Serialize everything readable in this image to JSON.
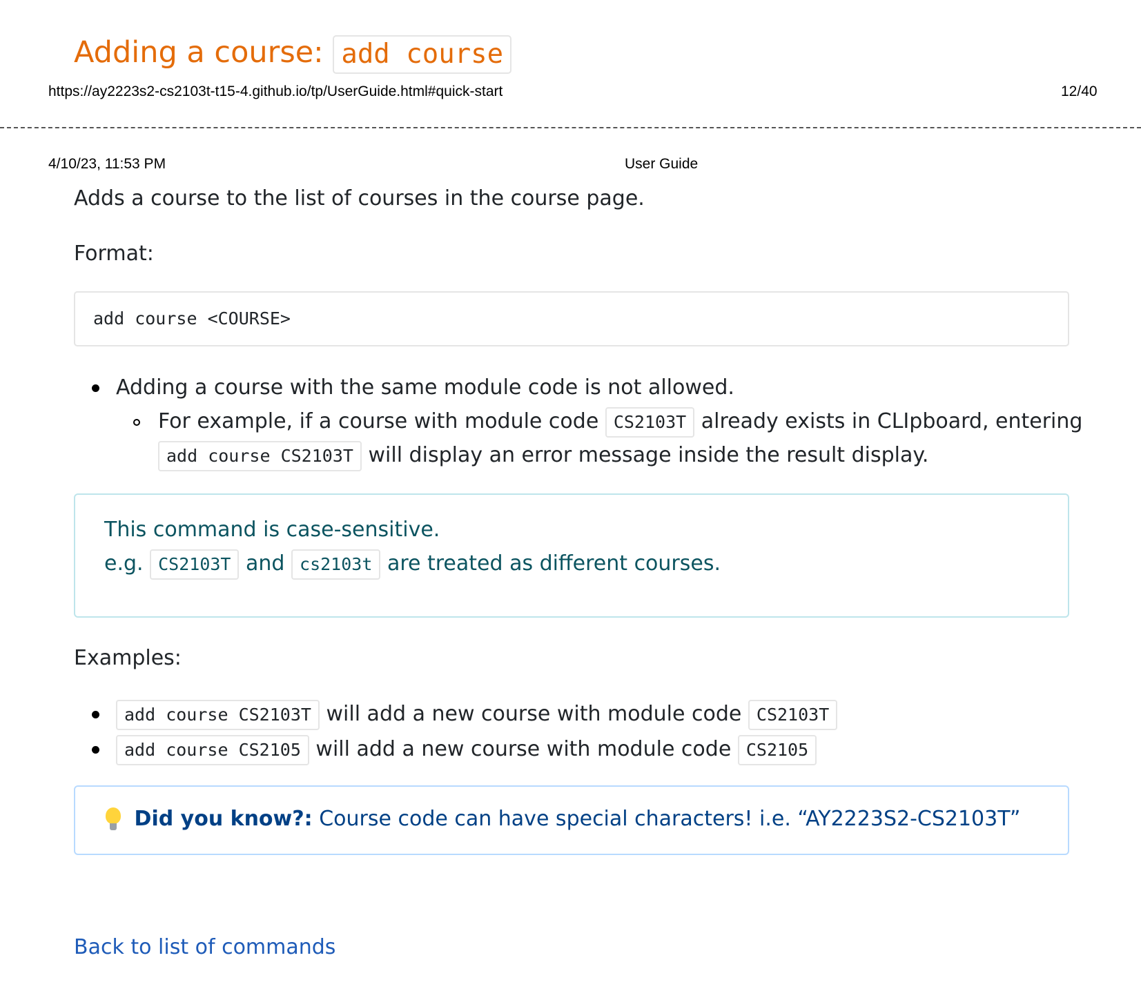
{
  "section_heading": {
    "text": "Adding a course:",
    "command": "add course"
  },
  "print_header_top": {
    "url": "https://ay2223s2-cs2103t-t15-4.github.io/tp/UserGuide.html#quick-start",
    "page_number": "12/40"
  },
  "print_header_page": {
    "datetime": "4/10/23, 11:53 PM",
    "title": "User Guide"
  },
  "description": "Adds a course to the list of courses in the course page.",
  "format_label": "Format:",
  "format_code": "add course <COURSE>",
  "notes": {
    "rule": "Adding a course with the same module code is not allowed.",
    "example_prefix": "For example, if a course with module code",
    "example_code": "CS2103T",
    "example_middle": "already exists in CLIpboard, entering",
    "example_command": "add course CS2103T",
    "example_suffix": "will display an error message inside the result display."
  },
  "info_box": {
    "line1": "This command is case-sensitive.",
    "prefix": "e.g.",
    "code1": "CS2103T",
    "conjunction": "and",
    "code2": "cs2103t",
    "suffix": "are treated as different courses."
  },
  "examples_label": "Examples:",
  "examples": [
    {
      "command": "add course CS2103T",
      "text": "will add a new course with module code",
      "code": "CS2103T"
    },
    {
      "command": "add course CS2105",
      "text": "will add a new course with module code",
      "code": "CS2105"
    }
  ],
  "tip": {
    "icon": "lightbulb-icon",
    "label": "Did you know?:",
    "text": "Course code can have special characters! i.e. “AY2223S2-CS2103T”"
  },
  "back_link": "Back to list of commands",
  "colors": {
    "heading": "#e46c0a",
    "info_text": "#0c5460",
    "info_border": "#bee5eb",
    "tip_text": "#004085",
    "tip_border": "#b8daff",
    "link": "#1e5bb8"
  }
}
